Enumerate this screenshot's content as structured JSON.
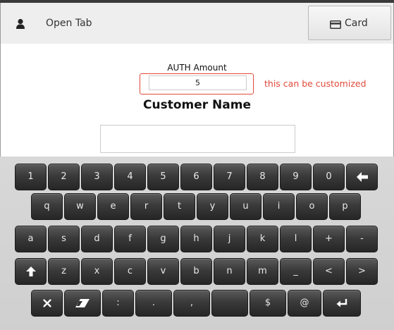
{
  "header": {
    "title": "Open Tab",
    "card_label": "Card"
  },
  "form": {
    "auth_label": "AUTH Amount",
    "auth_value": "5",
    "note": "this can be customized",
    "customer_name_label": "Customer Name",
    "customer_name_value": ""
  },
  "keyboard": {
    "row1": [
      "1",
      "2",
      "3",
      "4",
      "5",
      "6",
      "7",
      "8",
      "9",
      "0"
    ],
    "row2": [
      "q",
      "w",
      "e",
      "r",
      "t",
      "y",
      "u",
      "i",
      "o",
      "p"
    ],
    "row3": [
      "a",
      "s",
      "d",
      "f",
      "g",
      "h",
      "j",
      "k",
      "l",
      "+",
      "-"
    ],
    "row4": [
      "z",
      "x",
      "c",
      "v",
      "b",
      "n",
      "m",
      "_",
      "<",
      ">"
    ],
    "row5": [
      ":",
      ".",
      ",",
      "",
      "$",
      "@"
    ]
  },
  "colors": {
    "accent": "#e04a3a",
    "key_bg": "#333333",
    "keyboard_bg": "#d4d4d4"
  }
}
